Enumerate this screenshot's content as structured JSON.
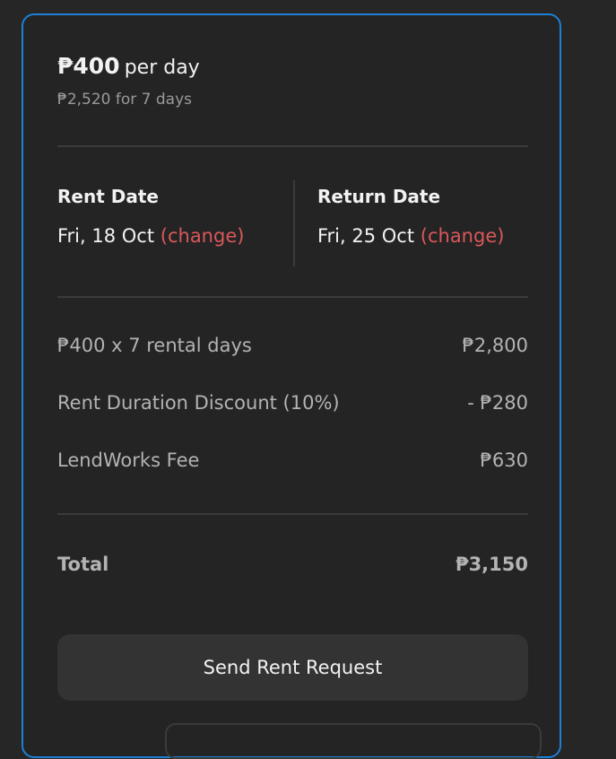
{
  "price": {
    "amount": "₱400",
    "unit": "per day",
    "summary": "₱2,520 for 7 days"
  },
  "dates": {
    "rent": {
      "label": "Rent Date",
      "value": "Fri, 18 Oct",
      "change_label": "(change)"
    },
    "return": {
      "label": "Return Date",
      "value": "Fri, 25 Oct",
      "change_label": "(change)"
    }
  },
  "breakdown": [
    {
      "label": "₱400 x 7 rental days",
      "value": "₱2,800"
    },
    {
      "label": "Rent Duration Discount (10%)",
      "value": "- ₱280"
    },
    {
      "label": "LendWorks Fee",
      "value": "₱630"
    }
  ],
  "total": {
    "label": "Total",
    "value": "₱3,150"
  },
  "actions": {
    "send_label": "Send Rent Request"
  },
  "colors": {
    "accent_border": "#1e7fd6",
    "change_link": "#d9585a",
    "background": "#262626",
    "button_bg": "#333333"
  }
}
